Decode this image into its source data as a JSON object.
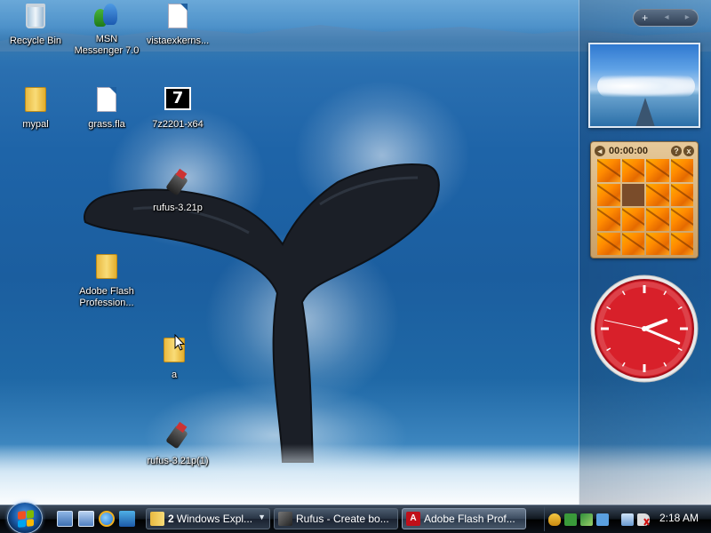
{
  "desktop": {
    "icons": [
      {
        "id": "recycle",
        "label": "Recycle Bin"
      },
      {
        "id": "msn",
        "label": "MSN Messenger 7.0"
      },
      {
        "id": "vista",
        "label": "vistaexkerns..."
      },
      {
        "id": "mypal",
        "label": "mypal"
      },
      {
        "id": "grass",
        "label": "grass.fla"
      },
      {
        "id": "7z",
        "label": "7z2201-x64"
      },
      {
        "id": "rufus1",
        "label": "rufus-3.21p"
      },
      {
        "id": "adobe",
        "label": "Adobe Flash Profession..."
      },
      {
        "id": "folder-a",
        "label": "a"
      },
      {
        "id": "rufus2",
        "label": "rufus-3.21p(1)"
      }
    ]
  },
  "sidebar": {
    "controls": {
      "add": "+",
      "prev": "◂",
      "next": "▸"
    },
    "puzzle": {
      "timer": "00:00:00",
      "help": "?",
      "close": "x",
      "left_btn": "◂"
    },
    "clock": {
      "hour": 2,
      "minute": 18,
      "second": 47,
      "face_color": "#d8202a"
    }
  },
  "taskbar": {
    "tasks": [
      {
        "count": "2",
        "label": "Windows Expl...",
        "has_arrow": true
      },
      {
        "label": "Rufus - Create bo..."
      },
      {
        "label": "Adobe Flash Prof..."
      }
    ],
    "time": "2:18 AM"
  },
  "colors": {
    "accent": "#1b5ca8",
    "clock_face": "#d8202a"
  }
}
